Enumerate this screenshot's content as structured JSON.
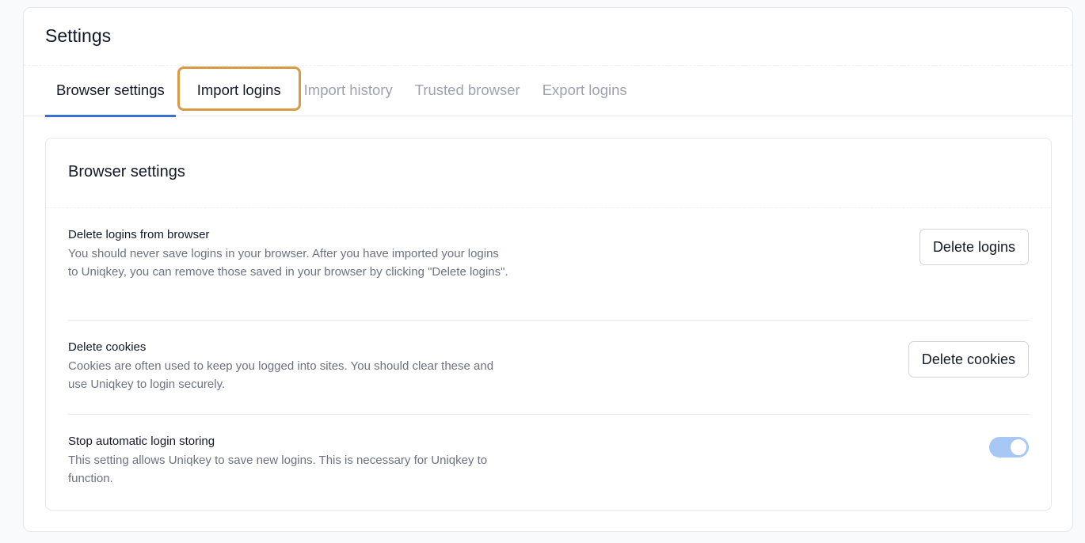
{
  "header": {
    "title": "Settings"
  },
  "tabs": [
    {
      "label": "Browser settings"
    },
    {
      "label": "Import logins"
    },
    {
      "label": "Import history"
    },
    {
      "label": "Trusted browser"
    },
    {
      "label": "Export logins"
    }
  ],
  "panel": {
    "title": "Browser settings",
    "settings": [
      {
        "title": "Delete logins from browser",
        "description": "You should never save logins in your browser. After you have imported your logins to Uniqkey, you can remove those saved in your browser by clicking \"Delete logins\".",
        "button_label": "Delete logins"
      },
      {
        "title": "Delete cookies",
        "description": "Cookies are often used to keep you logged into sites. You should clear these and use Uniqkey to login securely.",
        "button_label": "Delete cookies"
      },
      {
        "title": "Stop automatic login storing",
        "description": "This setting allows Uniqkey to save new logins. This is necessary for Uniqkey to function.",
        "toggle_on": true
      }
    ]
  },
  "colors": {
    "accent": "#3b6fd4",
    "highlight_outline": "#d99a45",
    "toggle_track": "#a7c7f4"
  }
}
